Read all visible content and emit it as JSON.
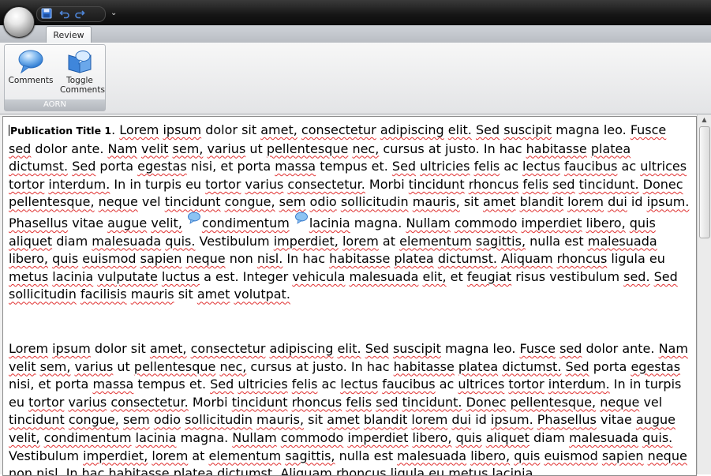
{
  "titlebar": {
    "qat": {
      "save": "save-icon",
      "undo": "undo-icon",
      "redo": "redo-icon",
      "dropdown_glyph": "⌄"
    }
  },
  "ribbon": {
    "tab": "Review",
    "group": {
      "label": "AORN",
      "buttons": [
        {
          "label": "Comments",
          "icon": "comment-bubble-icon"
        },
        {
          "label": "Toggle Comments",
          "icon": "toggle-comments-icon"
        }
      ]
    }
  },
  "document": {
    "title": "Publication Title 1",
    "p1": [
      ". ",
      [
        "Lorem"
      ],
      " ",
      [
        "ipsum"
      ],
      " dolor sit ",
      [
        "amet,"
      ],
      " ",
      [
        "consectetur"
      ],
      " ",
      [
        "adipiscing"
      ],
      " ",
      [
        "elit."
      ],
      " ",
      [
        "Sed"
      ],
      " ",
      [
        "suscipit"
      ],
      " magna leo. ",
      [
        "Fusce"
      ],
      " ",
      [
        "sed"
      ],
      " dolor ante. ",
      [
        "Nam"
      ],
      " ",
      [
        "velit"
      ],
      " ",
      [
        "sem,"
      ],
      " ",
      [
        "varius"
      ],
      " ut ",
      [
        "pellentesque"
      ],
      " ",
      [
        "nec,"
      ],
      " cursus at justo. In hac ",
      [
        "habitasse"
      ],
      " ",
      [
        "platea"
      ],
      " ",
      [
        "dictumst."
      ],
      " ",
      [
        "Sed"
      ],
      " porta ",
      [
        "egestas"
      ],
      " nisi, et porta ",
      [
        "massa"
      ],
      " tempus et. ",
      [
        "Sed"
      ],
      " ",
      [
        "ultricies"
      ],
      " ",
      [
        "felis"
      ],
      " ac ",
      [
        "lectus"
      ],
      " ",
      [
        "faucibus"
      ],
      " ac ",
      [
        "ultrices"
      ],
      " ",
      [
        "tortor"
      ],
      " ",
      [
        "interdum."
      ],
      " In in turpis eu ",
      [
        "tortor"
      ],
      " ",
      [
        "varius"
      ],
      " ",
      [
        "consectetur."
      ],
      " Morbi ",
      [
        "tincidunt"
      ],
      " ",
      [
        "rhoncus"
      ],
      " ",
      [
        "felis"
      ],
      " ",
      [
        "sed"
      ],
      " ",
      [
        "tincidunt."
      ],
      " ",
      [
        "Donec"
      ],
      " ",
      [
        "pellentesque,"
      ],
      " ",
      [
        "neque"
      ],
      " vel ",
      [
        "tincidunt"
      ],
      " ",
      [
        "congue,"
      ],
      " ",
      [
        "sem"
      ],
      " ",
      [
        "odio"
      ],
      " ",
      [
        "sollicitudin"
      ],
      " ",
      [
        "mauris,"
      ],
      " sit ",
      [
        "amet"
      ],
      " ",
      [
        "blandit"
      ],
      " ",
      [
        "lorem"
      ],
      " ",
      [
        "dui"
      ],
      " id ",
      [
        "ipsum."
      ],
      " ",
      [
        "Phasellus"
      ],
      " vitae ",
      [
        "augue"
      ],
      " ",
      [
        "velit,"
      ],
      {
        "comment": 1
      },
      [
        "condimentum"
      ],
      {
        "comment": 1
      },
      [
        "lacinia"
      ],
      " magna. ",
      [
        "Nullam"
      ],
      " ",
      [
        "commodo"
      ],
      " ",
      [
        "imperdiet"
      ],
      " ",
      [
        "libero,"
      ],
      " ",
      [
        "quis"
      ],
      " ",
      [
        "aliquet"
      ],
      " diam ",
      [
        "malesuada"
      ],
      " ",
      [
        "quis."
      ],
      " Vestibulum ",
      [
        "imperdiet,"
      ],
      " ",
      [
        "lorem"
      ],
      " at ",
      [
        "elementum"
      ],
      " ",
      [
        "sagittis,"
      ],
      " nulla est ",
      [
        "malesuada"
      ],
      " ",
      [
        "libero,"
      ],
      " ",
      [
        "quis"
      ],
      " ",
      [
        "euismod"
      ],
      " ",
      [
        "sapien"
      ],
      " ",
      [
        "neque"
      ],
      " non ",
      [
        "nisl."
      ],
      " In hac ",
      [
        "habitasse"
      ],
      " ",
      [
        "platea"
      ],
      " ",
      [
        "dictumst."
      ],
      " ",
      [
        "Aliquam"
      ],
      " ",
      [
        "rhoncus"
      ],
      " ligula eu ",
      [
        "metus"
      ],
      " ",
      [
        "lacinia"
      ],
      " ",
      [
        "vulputate"
      ],
      " ",
      [
        "luctus"
      ],
      " a est. Integer ",
      [
        "vehicula"
      ],
      " ",
      [
        "malesuada"
      ],
      " ",
      [
        "elit,"
      ],
      " et ",
      [
        "feugiat"
      ],
      " risus vestibulum ",
      [
        "sed."
      ],
      " ",
      [
        "Sed"
      ],
      " ",
      [
        "sollicitudin"
      ],
      " ",
      [
        "facilisis"
      ],
      " ",
      [
        "mauris"
      ],
      " sit ",
      [
        "amet"
      ],
      " ",
      [
        "volutpat."
      ]
    ],
    "p2": [
      [
        "Lorem"
      ],
      " ",
      [
        "ipsum"
      ],
      " dolor sit ",
      [
        "amet,"
      ],
      " ",
      [
        "consectetur"
      ],
      " ",
      [
        "adipiscing"
      ],
      " ",
      [
        "elit."
      ],
      " ",
      [
        "Sed"
      ],
      " ",
      [
        "suscipit"
      ],
      " magna leo. ",
      [
        "Fusce"
      ],
      " ",
      [
        "sed"
      ],
      " dolor ante. ",
      [
        "Nam"
      ],
      " ",
      [
        "velit"
      ],
      " ",
      [
        "sem,"
      ],
      " ",
      [
        "varius"
      ],
      " ut ",
      [
        "pellentesque"
      ],
      " ",
      [
        "nec,"
      ],
      " cursus at justo. In hac ",
      [
        "habitasse"
      ],
      " ",
      [
        "platea"
      ],
      " ",
      [
        "dictumst."
      ],
      " ",
      [
        "Sed"
      ],
      " porta ",
      [
        "egestas"
      ],
      " nisi, et porta ",
      [
        "massa"
      ],
      " tempus et. ",
      [
        "Sed"
      ],
      " ",
      [
        "ultricies"
      ],
      " ",
      [
        "felis"
      ],
      " ac ",
      [
        "lectus"
      ],
      " ",
      [
        "faucibus"
      ],
      " ac ",
      [
        "ultrices"
      ],
      " ",
      [
        "tortor"
      ],
      " ",
      [
        "interdum."
      ],
      " In in turpis eu ",
      [
        "tortor"
      ],
      " ",
      [
        "varius"
      ],
      " ",
      [
        "consectetur."
      ],
      " Morbi ",
      [
        "tincidunt"
      ],
      " ",
      [
        "rhoncus"
      ],
      " ",
      [
        "felis"
      ],
      " ",
      [
        "sed"
      ],
      " ",
      [
        "tincidunt."
      ],
      " ",
      [
        "Donec"
      ],
      " ",
      [
        "pellentesque,"
      ],
      " ",
      [
        "neque"
      ],
      " vel ",
      [
        "tincidunt"
      ],
      " ",
      [
        "congue,"
      ],
      " ",
      [
        "sem"
      ],
      " ",
      [
        "odio"
      ],
      " ",
      [
        "sollicitudin"
      ],
      " ",
      [
        "mauris,"
      ],
      " sit ",
      [
        "amet"
      ],
      " ",
      [
        "blandit"
      ],
      " ",
      [
        "lorem"
      ],
      " ",
      [
        "dui"
      ],
      " id ",
      [
        "ipsum."
      ],
      " ",
      [
        "Phasellus"
      ],
      " vitae ",
      [
        "augue"
      ],
      " ",
      [
        "velit,"
      ],
      " ",
      [
        "condimentum"
      ],
      " ",
      [
        "lacinia"
      ],
      " magna. ",
      [
        "Nullam"
      ],
      " ",
      [
        "commodo"
      ],
      " ",
      [
        "imperdiet"
      ],
      " ",
      [
        "libero,"
      ],
      " ",
      [
        "quis"
      ],
      " ",
      [
        "aliquet"
      ],
      " diam ",
      [
        "malesuada"
      ],
      " ",
      [
        "quis."
      ],
      " Vestibulum ",
      [
        "imperdiet,"
      ],
      " ",
      [
        "lorem"
      ],
      " at ",
      [
        "elementum"
      ],
      " ",
      [
        "sagittis,"
      ],
      " nulla est ",
      [
        "malesuada"
      ],
      " ",
      [
        "libero,"
      ],
      " ",
      [
        "quis"
      ],
      " ",
      [
        "euismod"
      ],
      " ",
      [
        "sapien"
      ],
      " ",
      [
        "neque"
      ],
      " non ",
      [
        "nisl."
      ],
      " In hac ",
      [
        "habitasse"
      ],
      " ",
      [
        "platea"
      ],
      " ",
      [
        "dictumst."
      ],
      " ",
      [
        "Aliquam"
      ],
      " ",
      [
        "rhoncus"
      ],
      " ",
      [
        "ligula"
      ],
      " eu ",
      [
        "metus"
      ],
      " ",
      [
        "lacinia"
      ]
    ]
  },
  "colors": {
    "spellcheck": "#e03030",
    "accent": "#3b82d6"
  }
}
